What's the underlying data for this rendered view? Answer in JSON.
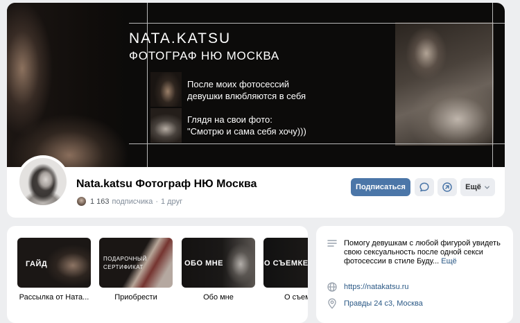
{
  "cover": {
    "brand": "NATA.KATSU",
    "subtitle": "ФОТОГРАФ НЮ МОСКВА",
    "line1": "После моих фотосессий",
    "line2": "девушки влюбляются в себя",
    "line3": "Глядя на свои фото:",
    "line4": "\"Смотрю и сама себя хочу)))"
  },
  "profile": {
    "name": "Nata.katsu Фотограф НЮ Москва",
    "followers": "1 163",
    "followers_label": "подписчика",
    "friends": "1 друг",
    "subscribe_label": "Подписаться",
    "more_label": "Ещё"
  },
  "links": [
    {
      "tile_label": "ГАЙД",
      "caption": "Рассылка от Ната..."
    },
    {
      "tile_label": "ПОДАРОЧНЫЙ",
      "tile_label_2": "СЕРТИФИКАТ",
      "caption": "Приобрести"
    },
    {
      "tile_label": "ОБО МНЕ",
      "caption": "Обо мне"
    },
    {
      "tile_label": "О СЪЕМКЕ",
      "caption": "О съем"
    }
  ],
  "info": {
    "description": "Помогу девушкам с любой фигурой увидеть свою сексуальность после одной секси фотосессии в стиле Буду...",
    "more": "Ещё",
    "site": "https://natakatsu.ru",
    "address": "Правды 24 с3, Москва"
  },
  "colors": {
    "accent": "#4b76a8",
    "link": "#2a5885",
    "page_bg": "#edeef0"
  }
}
